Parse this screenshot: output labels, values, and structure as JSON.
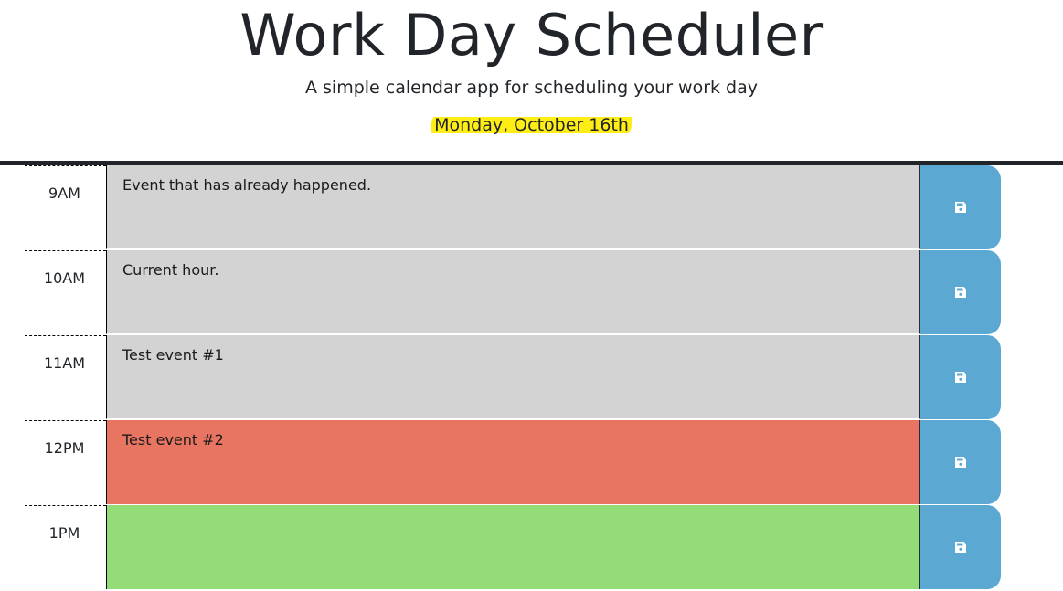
{
  "header": {
    "title": "Work Day Scheduler",
    "subtitle": "A simple calendar app for scheduling your work day",
    "current_date": "Monday, October 16th",
    "date_highlight_color": "#ffee16"
  },
  "colors": {
    "past": "#d3d3d3",
    "present": "#e87462",
    "future": "#94dc78",
    "save_button": "#5ba8d3"
  },
  "time_blocks": [
    {
      "hour": "9AM",
      "text": "Event that has already happened.",
      "status": "past",
      "save_icon": "floppy-disk-icon"
    },
    {
      "hour": "10AM",
      "text": "Current hour.",
      "status": "past",
      "save_icon": "floppy-disk-icon"
    },
    {
      "hour": "11AM",
      "text": "Test event #1",
      "status": "past",
      "save_icon": "floppy-disk-icon"
    },
    {
      "hour": "12PM",
      "text": "Test event #2",
      "status": "present",
      "save_icon": "floppy-disk-icon"
    },
    {
      "hour": "1PM",
      "text": "",
      "status": "future",
      "save_icon": "floppy-disk-icon"
    }
  ]
}
